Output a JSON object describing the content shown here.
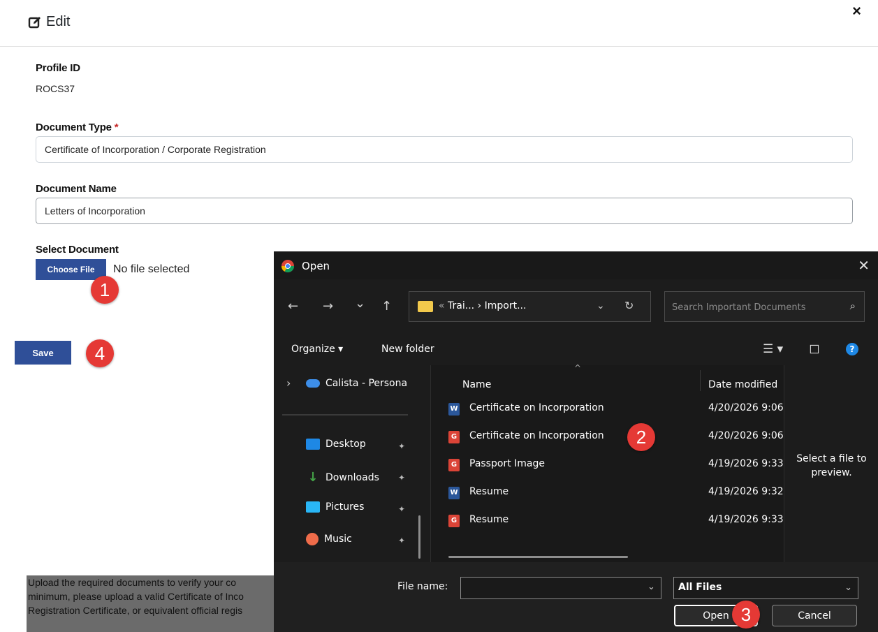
{
  "modal": {
    "title": "Edit",
    "close": "×",
    "profile_label": "Profile ID",
    "profile_value": "ROCS37",
    "doc_type_label": "Document Type",
    "required_mark": "*",
    "doc_type_value": "Certificate of Incorporation / Corporate Registration",
    "doc_name_label": "Document Name",
    "doc_name_value": "Letters of Incorporation",
    "select_label": "Select Document",
    "choose_button": "Choose File",
    "no_file": "No file selected",
    "save_button": "Save",
    "help_lines": [
      "Upload the required documents to verify your co",
      "minimum, please upload a valid Certificate of Inco",
      "Registration Certificate, or equivalent official regis"
    ]
  },
  "badges": [
    "1",
    "2",
    "3",
    "4"
  ],
  "dialog": {
    "title": "Open",
    "close": "✕",
    "nav": {
      "back": "←",
      "forward": "→",
      "recent": "⌄",
      "up": "↑"
    },
    "address": {
      "prefix": "«",
      "path": "Trai...  ›  Import...",
      "chevron": "⌄",
      "refresh": "↻"
    },
    "search_placeholder": "Search Important Documents",
    "search_icon": "⌕",
    "toolbar": {
      "organize": "Organize ▾",
      "new_folder": "New folder",
      "view": "☰ ▾",
      "pane": "◻",
      "help": "?"
    },
    "sidebar": {
      "expand": "›",
      "cloud": "Calista - Persona",
      "items": [
        {
          "label": "Desktop",
          "color": "#1e88e5"
        },
        {
          "label": "Downloads",
          "color": "#43a047"
        },
        {
          "label": "Pictures",
          "color": "#29b6f6"
        },
        {
          "label": "Music",
          "color": "#ef6c4a"
        }
      ],
      "pin": "✦"
    },
    "columns": {
      "name": "Name",
      "date": "Date modified",
      "sort": "^"
    },
    "files": [
      {
        "name": "Certificate on Incorporation",
        "date": "4/20/2026 9:06",
        "type": "word",
        "color": "#2b579a",
        "glyph": "W"
      },
      {
        "name": "Certificate on Incorporation",
        "date": "4/20/2026 9:06",
        "type": "chrome",
        "color": "#db4437",
        "glyph": "G"
      },
      {
        "name": "Passport Image",
        "date": "4/19/2026 9:33",
        "type": "chrome",
        "color": "#db4437",
        "glyph": "G"
      },
      {
        "name": "Resume",
        "date": "4/19/2026 9:32",
        "type": "word",
        "color": "#2b579a",
        "glyph": "W"
      },
      {
        "name": "Resume",
        "date": "4/19/2026 9:33",
        "type": "chrome",
        "color": "#db4437",
        "glyph": "G"
      }
    ],
    "preview": [
      "Select a file to",
      "preview."
    ],
    "file_name_label": "File name:",
    "file_name_value": "",
    "file_type": "All Files",
    "open_button": "Open",
    "cancel_button": "Cancel"
  },
  "colors": {
    "primary": "#2f4f98",
    "badge": "#e53935",
    "dialog_bg": "#191919"
  }
}
